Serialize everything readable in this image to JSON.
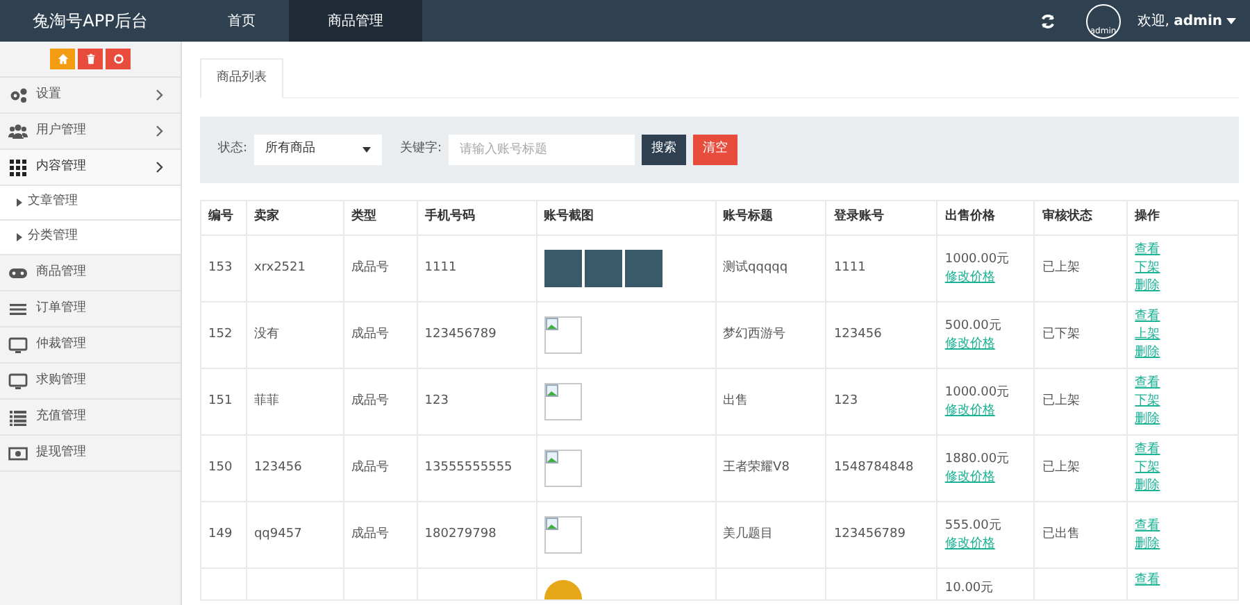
{
  "header": {
    "logo": "兔淘号APP后台",
    "nav": [
      {
        "label": "首页",
        "selected": false
      },
      {
        "label": "商品管理",
        "selected": true
      }
    ],
    "avatar_alt": "admin",
    "welcome": "欢迎, **admin**"
  },
  "sidebar": {
    "quick_buttons": [
      {
        "kind": "home",
        "color": "#f39c12"
      },
      {
        "kind": "trash",
        "color": "#e74c3c"
      },
      {
        "kind": "recycle",
        "color": "#e74c3c"
      }
    ],
    "items": [
      {
        "kind": "gears",
        "label": "设置",
        "expanded": false
      },
      {
        "kind": "users",
        "label": "用户管理",
        "expanded": false
      },
      {
        "kind": "grid",
        "label": "内容管理",
        "expanded": true,
        "children": [
          {
            "label": "文章管理"
          },
          {
            "label": "分类管理"
          }
        ]
      },
      {
        "kind": "gamepad",
        "label": "商品管理"
      },
      {
        "kind": "bars",
        "label": "订单管理"
      },
      {
        "kind": "monitor",
        "label": "仲裁管理"
      },
      {
        "kind": "monitor",
        "label": "求购管理"
      },
      {
        "kind": "list",
        "label": "充值管理"
      },
      {
        "kind": "money",
        "label": "提现管理"
      }
    ]
  },
  "tabs": [
    {
      "label": "商品列表",
      "selected": true
    }
  ],
  "filter": {
    "status_label": "状态:",
    "status_value": "所有商品",
    "keyword_label": "关键字:",
    "keyword_placeholder": "请输入账号标题",
    "search_button": "搜索",
    "clear_button": "清空"
  },
  "table": {
    "columns": [
      "编号",
      "卖家",
      "类型",
      "手机号码",
      "账号截图",
      "账号标题",
      "登录账号",
      "出售价格",
      "审核状态",
      "操作"
    ],
    "rows": [
      {
        "id": "153",
        "seller": "xrx2521",
        "type": "成品号",
        "phone": "1111",
        "screenshots": [
          {
            "kind": "photo"
          },
          {
            "kind": "photo"
          },
          {
            "kind": "photo"
          }
        ],
        "title": "测试qqqqq",
        "login": "1111",
        "price": "1000.00元",
        "price_link": "修改价格",
        "status": "已上架",
        "actions": [
          "查看",
          "下架",
          "删除"
        ]
      },
      {
        "id": "152",
        "seller": "没有",
        "type": "成品号",
        "phone": "123456789",
        "screenshots": [
          {
            "kind": "broken"
          }
        ],
        "title": "梦幻西游号",
        "login": "123456",
        "price": "500.00元",
        "price_link": "修改价格",
        "status": "已下架",
        "actions": [
          "查看",
          "上架",
          "删除"
        ]
      },
      {
        "id": "151",
        "seller": "菲菲",
        "type": "成品号",
        "phone": "123",
        "screenshots": [
          {
            "kind": "broken"
          }
        ],
        "title": "出售",
        "login": "123",
        "price": "1000.00元",
        "price_link": "修改价格",
        "status": "已上架",
        "actions": [
          "查看",
          "下架",
          "删除"
        ]
      },
      {
        "id": "150",
        "seller": "123456",
        "type": "成品号",
        "phone": "13555555555",
        "screenshots": [
          {
            "kind": "broken"
          }
        ],
        "title": "王者荣耀V8",
        "login": "1548784848",
        "price": "1880.00元",
        "price_link": "修改价格",
        "status": "已上架",
        "actions": [
          "查看",
          "下架",
          "删除"
        ]
      },
      {
        "id": "149",
        "seller": "qq9457",
        "type": "成品号",
        "phone": "180279798",
        "screenshots": [
          {
            "kind": "broken"
          }
        ],
        "title": "美几题目",
        "login": "123456789",
        "price": "555.00元",
        "price_link": "修改价格",
        "status": "已出售",
        "actions": [
          "查看",
          "删除"
        ]
      },
      {
        "screenshots": [
          {
            "kind": "logo"
          }
        ],
        "price": "10.00元",
        "actions": [
          "查看"
        ]
      }
    ]
  }
}
